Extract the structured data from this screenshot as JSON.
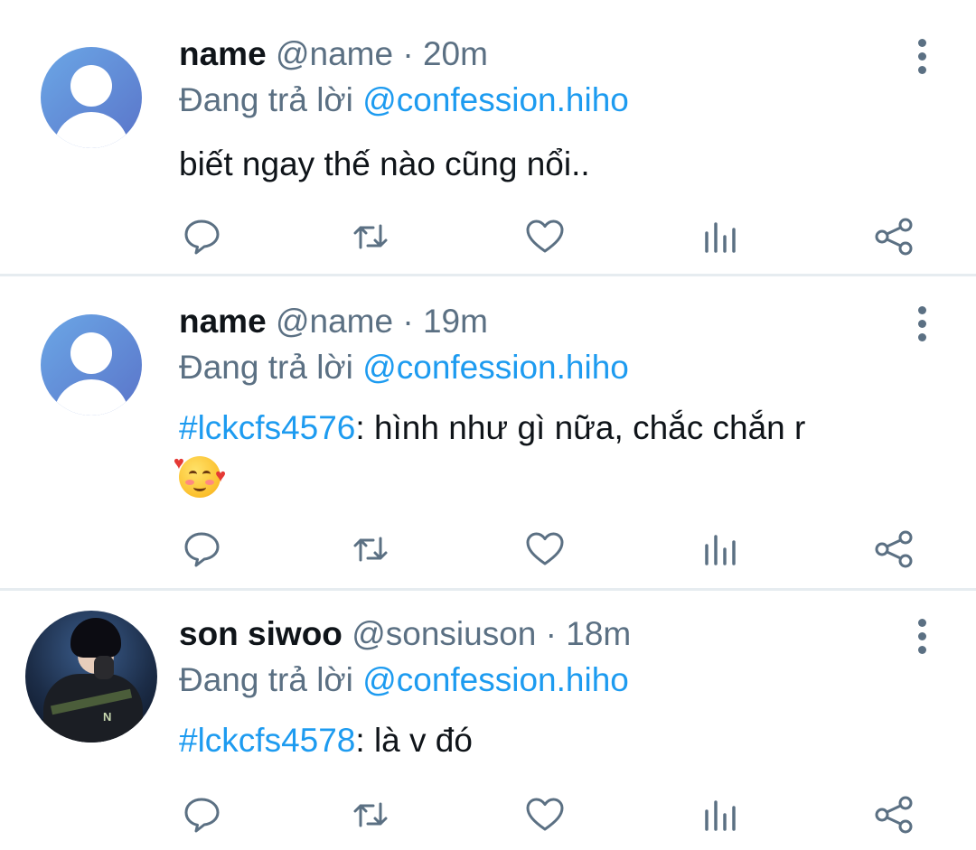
{
  "tweets": [
    {
      "name": "name",
      "handle": "@name",
      "sep": "·",
      "time": "20m",
      "reply_prefix": "Đang trả lời",
      "reply_to": "@confession.hiho",
      "hashtag": "",
      "text": "biết ngay thế nào cũng nổi..",
      "avatar": "default-avatar"
    },
    {
      "name": "name",
      "handle": "@name",
      "sep": "·",
      "time": "19m",
      "reply_prefix": "Đang trả lời",
      "reply_to": "@confession.hiho",
      "hashtag": "#lckcfs4576",
      "text": ": hình như gì nữa, chắc chắn r",
      "emoji": "smiling-face-with-hearts",
      "avatar": "default-avatar"
    },
    {
      "name": "son siwoo",
      "handle": "@sonsiuson",
      "sep": "·",
      "time": "18m",
      "reply_prefix": "Đang trả lời",
      "reply_to": "@confession.hiho",
      "hashtag": "#lckcfs4578",
      "text": ": là v đó",
      "avatar": "profile-photo"
    }
  ],
  "photo_logo": "N",
  "icons": [
    "reply-icon",
    "retweet-icon",
    "like-icon",
    "stats-icon",
    "share-icon",
    "more-options-icon"
  ],
  "colors": {
    "link": "#1d9bf0",
    "secondary": "#5b7083",
    "primary": "#0f1419",
    "divider": "#e6ecf0"
  }
}
